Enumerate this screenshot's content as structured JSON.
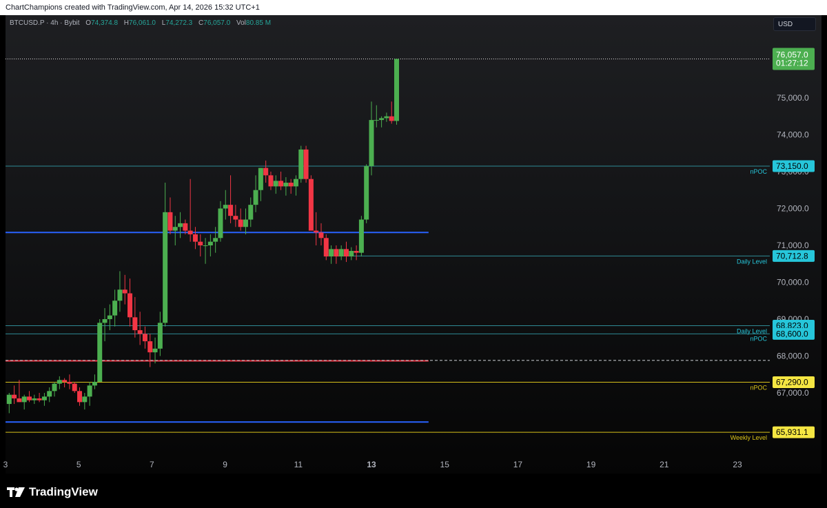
{
  "header": {
    "attribution": "ChartChampions created with TradingView.com, Apr 14, 2026 15:32 UTC+1"
  },
  "legend": {
    "symbol": "BTCUSD.P · 4h · Bybit",
    "open_label": "O",
    "open": "74,374.8",
    "high_label": "H",
    "high": "76,061.0",
    "low_label": "L",
    "low": "74,272.3",
    "close_label": "C",
    "close": "76,057.0",
    "volume_label": "Vol",
    "volume": "80.85 M"
  },
  "currency": "USD",
  "brand": "TradingView",
  "colors": {
    "up": "#4caf50",
    "down": "#f23645",
    "cyan_line": "#2f8b96",
    "blue_line": "#2962ff",
    "yellow_line": "#d9c21a",
    "red_line": "#f23645",
    "current_price": "#4caf50",
    "cyan_label": "#26c6da"
  },
  "chart_data": {
    "type": "candlestick",
    "interval": "4h",
    "x_ticks": [
      "3",
      "5",
      "7",
      "9",
      "11",
      "13",
      "15",
      "17",
      "19",
      "21",
      "23"
    ],
    "y_ticks": [
      "76,000.0",
      "75,000.0",
      "74,000.0",
      "73,000.0",
      "72,000.0",
      "71,000.0",
      "70,000.0",
      "69,000.0",
      "68,000.0",
      "67,000.0",
      "66,000.0"
    ],
    "ylim": [
      65500,
      76600
    ],
    "current_price": {
      "value": 76057.0,
      "label": "76,057.0",
      "countdown": "01:27:12"
    },
    "levels": [
      {
        "price": 73150.0,
        "label": "73,150.0",
        "tag": "nPOC",
        "style": "cyan",
        "from_day": 3
      },
      {
        "price": 71350.0,
        "label": "",
        "tag": "",
        "style": "blue",
        "from_day": 3,
        "to_day": 14.56
      },
      {
        "price": 70712.8,
        "label": "70,712.8",
        "tag": "Daily Level",
        "style": "cyan",
        "from_day": 11.98
      },
      {
        "price": 68823.0,
        "label": "68,823.0",
        "tag": "Daily Level",
        "style": "cyan",
        "from_day": 3
      },
      {
        "price": 68600.0,
        "label": "68,600.0",
        "tag": "nPOC",
        "style": "cyan",
        "from_day": 3
      },
      {
        "price": 67870.0,
        "label": "",
        "tag": "",
        "style": "red",
        "from_day": 3,
        "to_day": 14.56
      },
      {
        "price": 67290.0,
        "label": "67,290.0",
        "tag": "nPOC",
        "style": "yellow",
        "from_day": 3
      },
      {
        "price": 66210.0,
        "label": "",
        "tag": "",
        "style": "blue",
        "from_day": 3,
        "to_day": 14.56
      },
      {
        "price": 65931.1,
        "label": "65,931.1",
        "tag": "Weekly Level",
        "style": "yellow",
        "from_day": 3
      }
    ],
    "dashed_line_price": 67880.0,
    "candles": [
      [
        66700,
        67000,
        66450,
        66950
      ],
      [
        66950,
        67200,
        66700,
        66850
      ],
      [
        66850,
        67350,
        66800,
        66750
      ],
      [
        66750,
        66950,
        66550,
        66900
      ],
      [
        66900,
        67050,
        66750,
        66800
      ],
      [
        66800,
        66950,
        66700,
        66850
      ],
      [
        66850,
        67000,
        66750,
        66800
      ],
      [
        66800,
        67000,
        66650,
        66900
      ],
      [
        66900,
        67150,
        66750,
        67050
      ],
      [
        67050,
        67300,
        66900,
        67250
      ],
      [
        67250,
        67450,
        67100,
        67350
      ],
      [
        67350,
        67400,
        67150,
        67300
      ],
      [
        67300,
        67500,
        67100,
        67250
      ],
      [
        67250,
        67300,
        67000,
        67050
      ],
      [
        67050,
        67150,
        66650,
        66750
      ],
      [
        66750,
        67000,
        66550,
        66900
      ],
      [
        66900,
        67300,
        66650,
        67200
      ],
      [
        67200,
        67500,
        67100,
        67300
      ],
      [
        67300,
        69000,
        67300,
        68900
      ],
      [
        68900,
        69300,
        68400,
        69000
      ],
      [
        69000,
        69400,
        68700,
        69100
      ],
      [
        69100,
        69800,
        68800,
        69500
      ],
      [
        69500,
        70300,
        69200,
        69800
      ],
      [
        69800,
        70200,
        69400,
        69700
      ],
      [
        69700,
        70100,
        68800,
        69050
      ],
      [
        69050,
        69600,
        68500,
        68700
      ],
      [
        68700,
        69200,
        68300,
        68600
      ],
      [
        68600,
        68800,
        68200,
        68400
      ],
      [
        68400,
        68600,
        67700,
        68100
      ],
      [
        68100,
        68500,
        67800,
        68200
      ],
      [
        68200,
        69200,
        68000,
        68900
      ],
      [
        68900,
        72700,
        68800,
        71900
      ],
      [
        71900,
        72300,
        71300,
        71400
      ],
      [
        71400,
        71800,
        71000,
        71500
      ],
      [
        71500,
        71900,
        71200,
        71600
      ],
      [
        71600,
        71700,
        71300,
        71400
      ],
      [
        71400,
        72800,
        71100,
        71300
      ],
      [
        71300,
        71500,
        70900,
        71100
      ],
      [
        71100,
        71300,
        70700,
        71000
      ],
      [
        71000,
        71200,
        70500,
        71000
      ],
      [
        71000,
        71300,
        70700,
        71100
      ],
      [
        71100,
        71500,
        70800,
        71200
      ],
      [
        71200,
        72200,
        71100,
        72000
      ],
      [
        72000,
        72500,
        71700,
        72100
      ],
      [
        72100,
        72900,
        71600,
        71800
      ],
      [
        71800,
        72100,
        71500,
        71700
      ],
      [
        71700,
        72000,
        71400,
        71500
      ],
      [
        71500,
        72000,
        71300,
        71700
      ],
      [
        71700,
        72300,
        71500,
        72100
      ],
      [
        72100,
        72900,
        71900,
        72500
      ],
      [
        72500,
        73100,
        72200,
        73100
      ],
      [
        73100,
        73300,
        72700,
        72900
      ],
      [
        72900,
        73000,
        72500,
        72600
      ],
      [
        72600,
        72900,
        72400,
        72750
      ],
      [
        72750,
        73000,
        72500,
        72600
      ],
      [
        72600,
        72850,
        72350,
        72700
      ],
      [
        72700,
        72800,
        72400,
        72600
      ],
      [
        72600,
        72900,
        72350,
        72800
      ],
      [
        72800,
        73700,
        72700,
        73600
      ],
      [
        73600,
        73700,
        72700,
        72800
      ],
      [
        72800,
        72900,
        71500,
        71400
      ],
      [
        71400,
        71900,
        71000,
        71350
      ],
      [
        71350,
        71600,
        71000,
        71200
      ],
      [
        71200,
        71300,
        70600,
        70700
      ],
      [
        70700,
        71000,
        70500,
        70900
      ],
      [
        70900,
        71000,
        70500,
        70700
      ],
      [
        70700,
        71000,
        70600,
        70900
      ],
      [
        70900,
        71100,
        70550,
        70700
      ],
      [
        70700,
        70950,
        70600,
        70850
      ],
      [
        70850,
        71000,
        70600,
        70800
      ],
      [
        70800,
        71800,
        70700,
        71700
      ],
      [
        71700,
        73200,
        71600,
        73150
      ],
      [
        73150,
        74900,
        72900,
        74400
      ],
      [
        74400,
        74800,
        74200,
        74400
      ],
      [
        74400,
        74500,
        74200,
        74450
      ],
      [
        74450,
        74600,
        74350,
        74500
      ],
      [
        74500,
        74900,
        74300,
        74374.8
      ],
      [
        74374.8,
        76061,
        74272.3,
        76057
      ]
    ]
  }
}
